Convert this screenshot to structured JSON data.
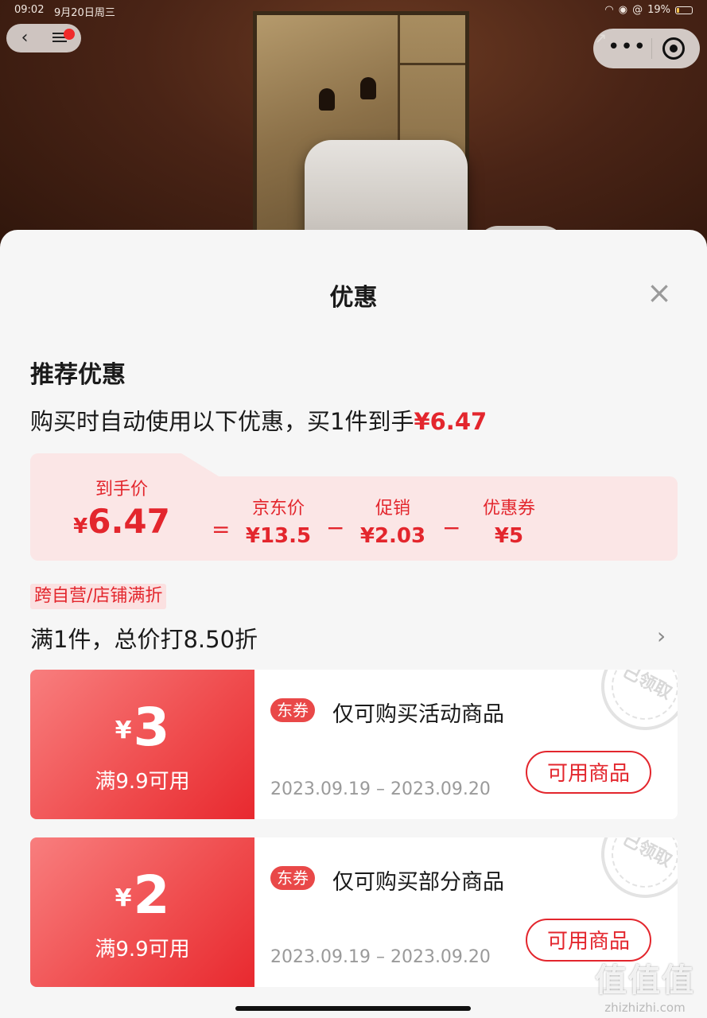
{
  "status_bar": {
    "time": "09:02",
    "date": "9月20日周三",
    "battery": "19%",
    "battery_level": 0.19
  },
  "sheet": {
    "title": "优惠",
    "recommend": {
      "title": "推荐优惠",
      "desc_prefix": "购买时自动使用以下优惠，买1件到手",
      "final_price": "¥6.47"
    },
    "breakdown": {
      "final_label": "到手价",
      "final_yen": "¥",
      "final_value": "6.47",
      "equals": "=",
      "jd_label": "京东价",
      "jd_value": "¥13.5",
      "minus1": "−",
      "promo_label": "促销",
      "promo_value": "¥2.03",
      "minus2": "−",
      "coupon_label": "优惠券",
      "coupon_value": "¥5"
    },
    "promotion": {
      "tag": "跨自营/店铺满折",
      "text": "满1件，总价打8.50折"
    },
    "coupons": [
      {
        "yen": "¥",
        "amount": "3",
        "condition": "满9.9可用",
        "badge": "东券",
        "desc": "仅可购买活动商品",
        "date": "2023.09.19 – 2023.09.20",
        "button": "可用商品",
        "stamp": "已领取"
      },
      {
        "yen": "¥",
        "amount": "2",
        "condition": "满9.9可用",
        "badge": "东券",
        "desc": "仅可购买部分商品",
        "date": "2023.09.19 – 2023.09.20",
        "button": "可用商品",
        "stamp": "已领取"
      }
    ]
  },
  "watermark": {
    "logo": "值值值",
    "domain": "zhizhizhi.com"
  },
  "colors": {
    "accent_red": "#e3262d",
    "sheet_bg": "#f6f6f6",
    "breakdown_bg": "#fbe6e6"
  }
}
